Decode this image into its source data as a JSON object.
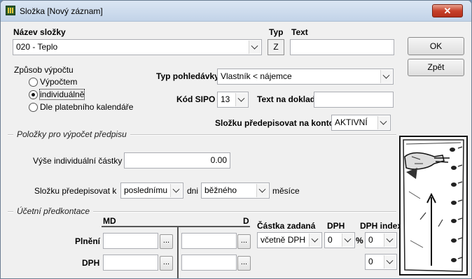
{
  "window": {
    "title": "Složka  [Nový záznam]",
    "close_glyph": "✕"
  },
  "top": {
    "nazev_label": "Název složky",
    "nazev_value": "020 - Teplo",
    "typ_label": "Typ",
    "typ_value": "Z",
    "text_label": "Text",
    "text_value": ""
  },
  "buttons": {
    "ok": "OK",
    "zpet": "Zpět"
  },
  "zpusob": {
    "label": "Způsob výpočtu",
    "options": [
      {
        "label": "Výpočtem",
        "selected": false
      },
      {
        "label": "individuálně",
        "selected": true
      },
      {
        "label": "Dle platebního kalendáře",
        "selected": false
      }
    ]
  },
  "typ_pohledavky": {
    "label": "Typ pohledávky",
    "value": "Vlastník < nájemce"
  },
  "kod_sipo": {
    "label": "Kód SIPO",
    "value": "13"
  },
  "text_na_doklad": {
    "label": "Text na doklad",
    "value": ""
  },
  "predepisovat_konto": {
    "label": "Složku předepisovat na konto",
    "value": "AKTIVNÍ"
  },
  "polozky": {
    "title": "Položky pro výpočet předpisu",
    "vyse_label": "Výše individuální částky",
    "vyse_value": "0.00",
    "predepisovat_label": "Složku předepisovat k",
    "predepisovat_value": "poslednímu",
    "dni_label": "dni",
    "mesic_value": "běžného",
    "mesice_label": "měsíce"
  },
  "predkontace": {
    "title": "Účetní předkontace",
    "md_label": "MD",
    "d_label": "D",
    "castka_label": "Částka zadaná",
    "dph_col_label": "DPH",
    "dph_index_label": "DPH index",
    "rows": [
      {
        "label": "Plnění",
        "md": "",
        "d": "",
        "castka": "včetně DPH",
        "dph": "0",
        "percent": "%",
        "dph_index": "0"
      },
      {
        "label": "DPH",
        "md": "",
        "d": "",
        "dph_index": "0"
      }
    ],
    "ellipsis": "..."
  }
}
